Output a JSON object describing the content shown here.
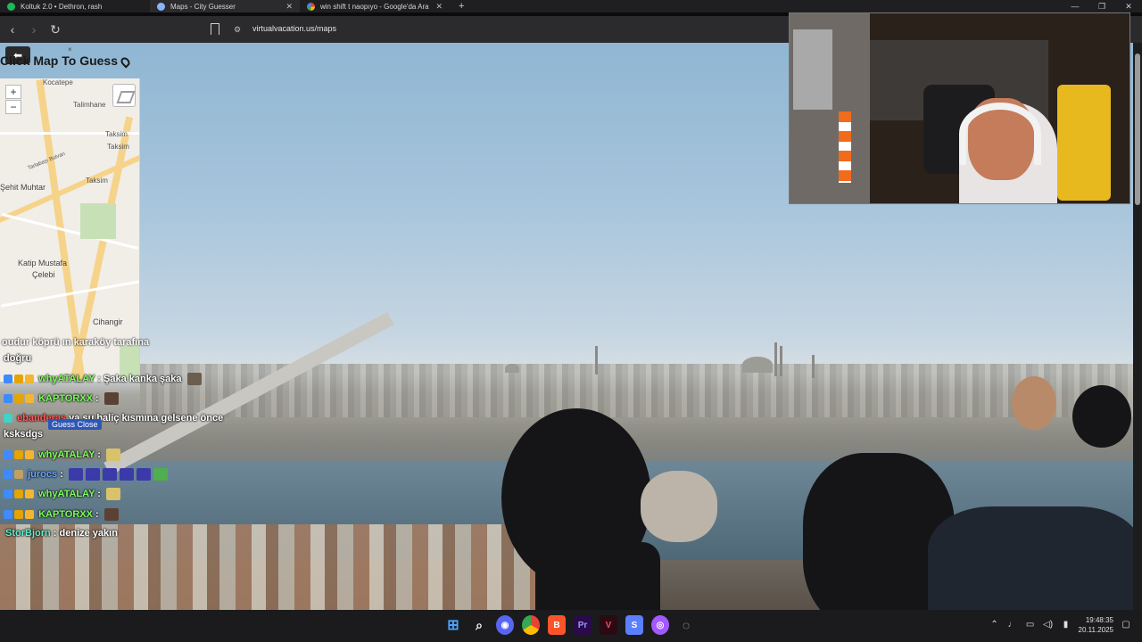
{
  "browser": {
    "tabs": [
      {
        "title": "Koltuk 2.0 • Dethron, rash",
        "icon": "spotify-icon",
        "color": "#1db954",
        "active": false
      },
      {
        "title": "Maps - City Guesser",
        "icon": "globe-icon",
        "color": "#8ab4f8",
        "active": true
      },
      {
        "title": "win shift t naopıyo - Google'da Ara",
        "icon": "google-icon",
        "color": "#ffffff",
        "active": false
      }
    ],
    "url": "virtualvacation.us/maps",
    "window_controls": [
      "—",
      "❐",
      "✕"
    ]
  },
  "map_panel": {
    "title": "Click Map To Guess",
    "close_label": "×",
    "zoom_in": "+",
    "zoom_out": "−",
    "labels": [
      "Kocatepe",
      "Talimhane",
      "Taksim",
      "Taksim",
      "Tarlabaşı Bulvarı",
      "Şehit Muhtar",
      "Katip Mustafa",
      "Çelebi",
      "Cihangir",
      "Taksim"
    ],
    "guess_button": "Guess Close"
  },
  "chat": {
    "messages": [
      {
        "user": "",
        "text": "oudur köprü ın karaköy tarafına",
        "color": "#ffffff"
      },
      {
        "user": "",
        "text": "doğru",
        "color": "#ffffff"
      },
      {
        "user": "whyATALAY",
        "text": ": Şaka kanka şaka",
        "color": "#7dff5c"
      },
      {
        "user": "KAPTORXX",
        "text": ":",
        "color": "#7dff5c"
      },
      {
        "user": "ebanderas",
        "text": "ya şu haliç kısmına gelsene önce",
        "color": "#ff5b5b"
      },
      {
        "user": "",
        "text": "ksksdgs",
        "color": "#ffffff"
      },
      {
        "user": "whyATALAY",
        "text": ":",
        "color": "#7dff5c"
      },
      {
        "user": "jurocs",
        "text": ":",
        "color": "#6ba6ff"
      },
      {
        "user": "whyATALAY",
        "text": ":",
        "color": "#7dff5c"
      },
      {
        "user": "KAPTORXX",
        "text": ":",
        "color": "#7dff5c"
      },
      {
        "user": "StorBjorn",
        "text": ": denize yakın",
        "color": "#5ff0d0"
      }
    ]
  },
  "taskbar": {
    "apps": [
      {
        "name": "start-icon",
        "glyph": "⊞",
        "color": "#4aa3ff"
      },
      {
        "name": "search-icon",
        "glyph": "⌕",
        "color": "#ffffff"
      },
      {
        "name": "discord-icon",
        "glyph": "◉",
        "color": "#5865f2"
      },
      {
        "name": "chrome-icon",
        "glyph": "◍",
        "color": "#e8453c"
      },
      {
        "name": "brave-icon",
        "glyph": "B",
        "color": "#fb542b"
      },
      {
        "name": "premiere-icon",
        "glyph": "Pr",
        "color": "#9999ff"
      },
      {
        "name": "valorant-icon",
        "glyph": "V",
        "color": "#ff4655"
      },
      {
        "name": "app-icon",
        "glyph": "S",
        "color": "#5a7fff"
      },
      {
        "name": "obs-icon",
        "glyph": "◎",
        "color": "#a259ff"
      },
      {
        "name": "settings-icon",
        "glyph": "◌",
        "color": "#cfcfcf"
      }
    ],
    "time": "19:48:35",
    "date": "20.11.2025"
  }
}
